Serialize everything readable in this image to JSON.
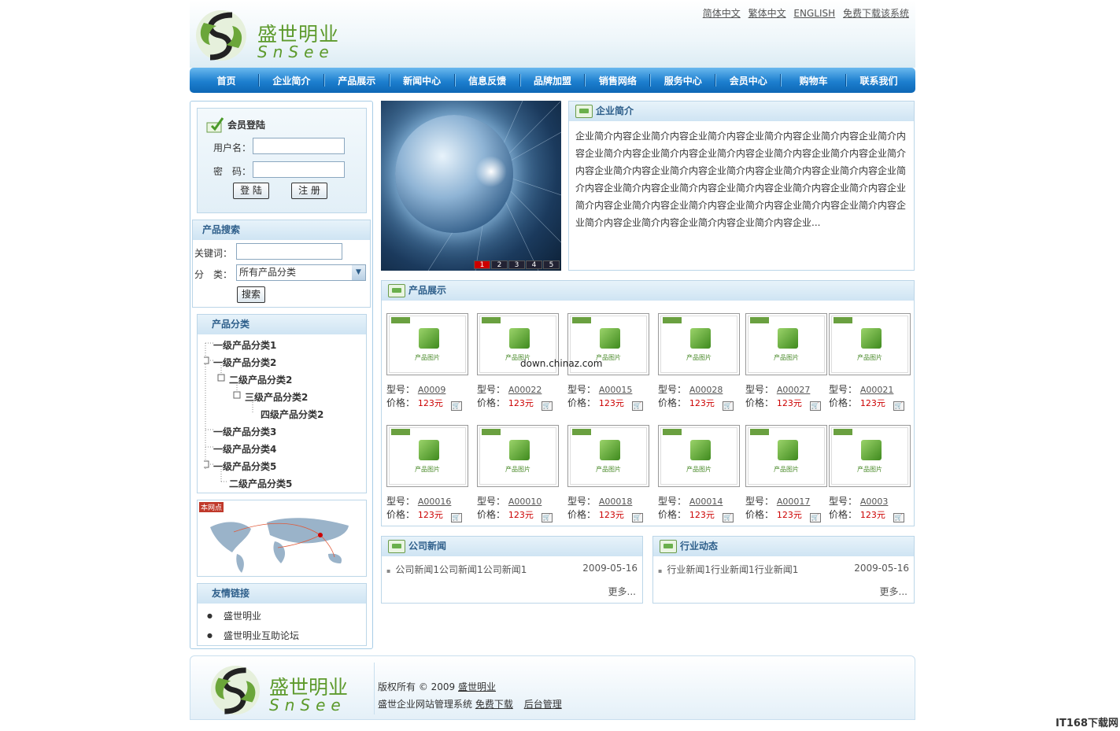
{
  "header": {
    "logo_cn": "盛世明业",
    "logo_en": "SnSee",
    "langs": [
      "简体中文",
      "繁体中文",
      "ENGLISH",
      "免费下载该系统"
    ]
  },
  "nav": [
    "首页",
    "企业简介",
    "产品展示",
    "新闻中心",
    "信息反馈",
    "品牌加盟",
    "销售网络",
    "服务中心",
    "会员中心",
    "购物车",
    "联系我们"
  ],
  "login": {
    "title": "会员登陆",
    "user_label": "用户名：",
    "pass_label": "密　码：",
    "login_btn": "登 陆",
    "register_btn": "注 册"
  },
  "search": {
    "title": "产品搜索",
    "keyword_label": "关键词：",
    "category_label": "分　类：",
    "category_selected": "所有产品分类",
    "button": "搜索"
  },
  "categories": {
    "title": "产品分类",
    "items": [
      "一级产品分类1",
      "一级产品分类2",
      "二级产品分类2",
      "三级产品分类2",
      "四级产品分类2",
      "一级产品分类3",
      "一级产品分类4",
      "一级产品分类5",
      "二级产品分类5"
    ]
  },
  "map_badge": "本网点",
  "links": {
    "title": "友情链接",
    "items": [
      "盛世明业",
      "盛世明业互助论坛"
    ]
  },
  "banner_pages": [
    "1",
    "2",
    "3",
    "4",
    "5"
  ],
  "about": {
    "title": "企业简介",
    "text": "企业简介内容企业简介内容企业简介内容企业简介内容企业简介内容企业简介内容企业简介内容企业简介内容企业简介内容企业简介内容企业简介内容企业简介内容企业简介内容企业简介内容企业简介内容企业简介内容企业简介内容企业简介内容企业简介内容企业简介内容企业简介内容企业简介内容企业简介内容企业简介内容企业简介内容企业简介内容企业简介内容企业简介内容企业简介内容企业简介内容企业简介内容企业简介内容企业简介内容企业..."
  },
  "products": {
    "title": "产品展示",
    "image_caption": "产品图片",
    "model_label": "型号：",
    "price_label": "价格：",
    "items": [
      {
        "model": "A0009",
        "price": "123元"
      },
      {
        "model": "A00022",
        "price": "123元"
      },
      {
        "model": "A00015",
        "price": "123元"
      },
      {
        "model": "A00028",
        "price": "123元"
      },
      {
        "model": "A00027",
        "price": "123元"
      },
      {
        "model": "A00021",
        "price": "123元"
      },
      {
        "model": "A00016",
        "price": "123元"
      },
      {
        "model": "A00010",
        "price": "123元"
      },
      {
        "model": "A00018",
        "price": "123元"
      },
      {
        "model": "A00014",
        "price": "123元"
      },
      {
        "model": "A00017",
        "price": "123元"
      },
      {
        "model": "A0003",
        "price": "123元"
      }
    ]
  },
  "watermark": "down.chinaz.com",
  "company_news": {
    "title": "公司新闻",
    "item": "公司新闻1公司新闻1公司新闻1",
    "date": "2009-05-16",
    "more": "更多..."
  },
  "industry_news": {
    "title": "行业动态",
    "item": "行业新闻1行业新闻1行业新闻1",
    "date": "2009-05-16",
    "more": "更多..."
  },
  "footer": {
    "logo_cn": "盛世明业",
    "logo_en": "SnSee",
    "copyright": "版权所有 © 2009",
    "copyright_link": "盛世明业",
    "system": "盛世企业网站管理系统",
    "download": "免费下载",
    "admin": "后台管理"
  },
  "site_watermark": "IT168下载网"
}
